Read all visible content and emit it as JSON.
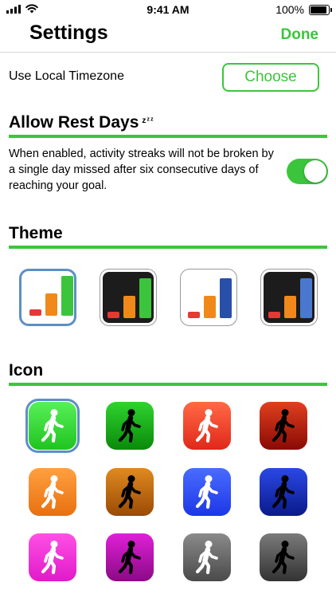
{
  "status_bar": {
    "time": "9:41 AM",
    "battery_text": "100%",
    "battery_level": 1.0
  },
  "nav": {
    "title": "Settings",
    "done_label": "Done"
  },
  "timezone": {
    "label": "Use Local Timezone",
    "button_label": "Choose"
  },
  "rest_days": {
    "title": "Allow Rest Days",
    "zzz": "zᶻᶻ",
    "description": "When enabled, activity streaks will not be broken by a single day missed after six consecutive days of reaching your goal.",
    "enabled": true
  },
  "theme": {
    "title": "Theme",
    "selected_index": 0,
    "options": [
      {
        "background": "#ffffff",
        "bars": [
          "#e53935",
          "#f0891a",
          "#3cc53c"
        ]
      },
      {
        "background": "#1c1c1c",
        "bars": [
          "#e53935",
          "#f0891a",
          "#3cc53c"
        ]
      },
      {
        "background": "#ffffff",
        "bars": [
          "#e53935",
          "#f0891a",
          "#2a4fa8"
        ]
      },
      {
        "background": "#1c1c1c",
        "bars": [
          "#e53935",
          "#f0891a",
          "#4a78d0"
        ]
      }
    ]
  },
  "icon": {
    "title": "Icon",
    "selected_index": 0,
    "options": [
      {
        "name": "walker-icon-green-white",
        "top": "#58f058",
        "bottom": "#1fc41f",
        "figure": "#ffffff"
      },
      {
        "name": "walker-icon-green-black",
        "top": "#2fd32f",
        "bottom": "#0a8a0a",
        "figure": "#000000"
      },
      {
        "name": "walker-icon-red-white",
        "top": "#ff6a45",
        "bottom": "#e0281a",
        "figure": "#ffffff"
      },
      {
        "name": "walker-icon-red-black",
        "top": "#e0401e",
        "bottom": "#8a0a05",
        "figure": "#000000"
      },
      {
        "name": "walker-icon-orange-white",
        "top": "#ffa040",
        "bottom": "#e8700f",
        "figure": "#ffffff"
      },
      {
        "name": "walker-icon-orange-black",
        "top": "#e08a20",
        "bottom": "#9a4a05",
        "figure": "#000000"
      },
      {
        "name": "walker-icon-blue-white",
        "top": "#4a6cff",
        "bottom": "#1c37e6",
        "figure": "#ffffff"
      },
      {
        "name": "walker-icon-blue-black",
        "top": "#2a48e6",
        "bottom": "#0a1a8a",
        "figure": "#000000"
      },
      {
        "name": "walker-icon-magenta-white",
        "top": "#ff50e6",
        "bottom": "#e01ac8",
        "figure": "#ffffff"
      },
      {
        "name": "walker-icon-magenta-black",
        "top": "#e020d8",
        "bottom": "#8a0a84",
        "figure": "#000000"
      },
      {
        "name": "walker-icon-gray-white",
        "top": "#8a8a8a",
        "bottom": "#4a4a4a",
        "figure": "#ffffff"
      },
      {
        "name": "walker-icon-gray-black",
        "top": "#7a7a7a",
        "bottom": "#333333",
        "figure": "#000000"
      }
    ]
  },
  "colors": {
    "accent": "#3cc53c",
    "selection": "#5d8fc4"
  }
}
